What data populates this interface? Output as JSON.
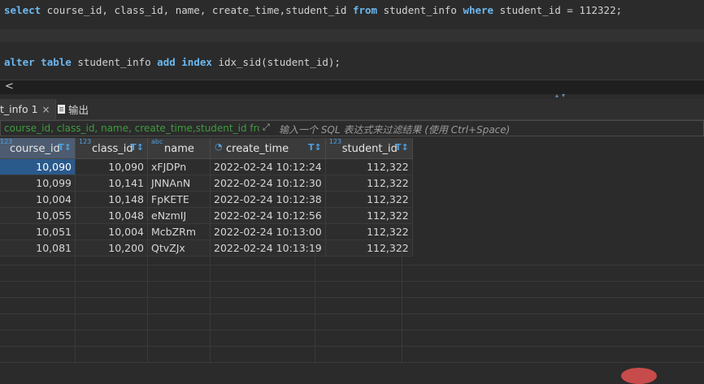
{
  "editor": {
    "line1": {
      "kw1": "select",
      "cols": " course_id, class_id, name, create_time,student_id ",
      "kw2": "from",
      "tbl": " student_info ",
      "kw3": "where",
      "cond": " student_id = ",
      "val": "112322",
      "end": ";"
    },
    "line3": {
      "kw1": "alter",
      "sp1": " ",
      "kw2": "table",
      "tbl": " student_info ",
      "kw3": "add",
      "sp2": " ",
      "kw4": "index",
      "rest": " idx_sid(student_id);"
    }
  },
  "scroll": {
    "left_arrow": "<"
  },
  "tabs": [
    {
      "label": "t_info 1",
      "close": "×"
    },
    {
      "label": "输出"
    }
  ],
  "filter": {
    "text": "course_id, class_id, name, create_time,student_id from",
    "placeholder": "输入一个 SQL 表达式来过滤结果 (使用 Ctrl+Space)",
    "expand_icon": "⤢"
  },
  "grid": {
    "columns": [
      {
        "type": "123",
        "name": "course_id"
      },
      {
        "type": "123",
        "name": "class_id"
      },
      {
        "type": "abc",
        "name": "name"
      },
      {
        "type": "clock",
        "name": "create_time"
      },
      {
        "type": "123",
        "name": "student_id"
      }
    ],
    "sort_glyph": "T↕",
    "rows": [
      [
        "10,090",
        "10,090",
        "xFJDPn",
        "2022-02-24 10:12:24",
        "112,322"
      ],
      [
        "10,099",
        "10,141",
        "JNNAnN",
        "2022-02-24 10:12:30",
        "112,322"
      ],
      [
        "10,004",
        "10,148",
        "FpKETE",
        "2022-02-24 10:12:38",
        "112,322"
      ],
      [
        "10,055",
        "10,048",
        "eNzmIJ",
        "2022-02-24 10:12:56",
        "112,322"
      ],
      [
        "10,051",
        "10,004",
        "McbZRm",
        "2022-02-24 10:13:00",
        "112,322"
      ],
      [
        "10,081",
        "10,200",
        "QtvZJx",
        "2022-02-24 10:13:19",
        "112,322"
      ]
    ]
  }
}
